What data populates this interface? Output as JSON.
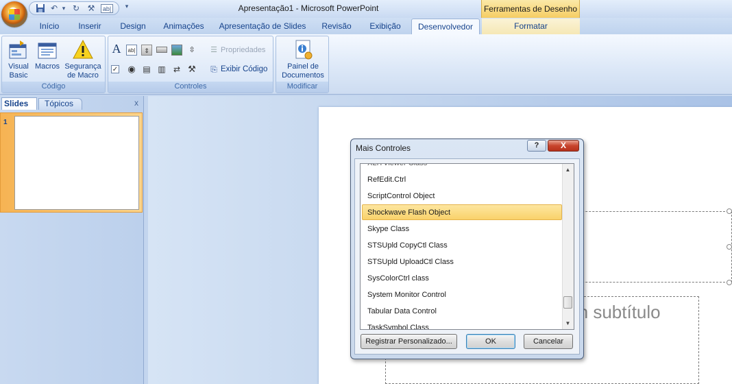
{
  "window": {
    "title": "Apresentação1 - Microsoft PowerPoint",
    "context_tab_group": "Ferramentas de Desenho"
  },
  "quick_access": {
    "icons": [
      "save-icon",
      "undo-icon",
      "redo-icon",
      "tools-icon",
      "textbox-icon",
      "dropdown-icon"
    ]
  },
  "tabs": [
    {
      "label": "Início"
    },
    {
      "label": "Inserir"
    },
    {
      "label": "Design"
    },
    {
      "label": "Animações"
    },
    {
      "label": "Apresentação de Slides"
    },
    {
      "label": "Revisão"
    },
    {
      "label": "Exibição"
    },
    {
      "label": "Desenvolvedor",
      "active": true
    },
    {
      "label": "Formatar"
    }
  ],
  "ribbon": {
    "codigo": {
      "label": "Código",
      "visual_basic": "Visual Basic",
      "visual_basic_l1": "Visual",
      "visual_basic_l2": "Basic",
      "macros": "Macros",
      "seguranca_l1": "Segurança",
      "seguranca_l2": "de Macro"
    },
    "controles": {
      "label": "Controles",
      "propriedades": "Propriedades",
      "exibir_codigo": "Exibir Código"
    },
    "modificar": {
      "label": "Modificar",
      "painel_l1": "Painel de",
      "painel_l2": "Documentos"
    }
  },
  "left_panel": {
    "tab_slides": "Slides",
    "tab_topicos": "Tópicos",
    "close": "x",
    "slide_number": "1"
  },
  "slide": {
    "subtitle_placeholder": "um subtítulo"
  },
  "dialog": {
    "title": "Mais Controles",
    "help": "?",
    "close": "X",
    "items": [
      "RefEdit.Ctrl",
      "ScriptControl Object",
      "Shockwave Flash Object",
      "Skype Class",
      "STSUpld CopyCtl Class",
      "STSUpld UploadCtl Class",
      "SysColorCtrl class",
      "System Monitor Control",
      "Tabular Data Control",
      "TaskSymbol Class"
    ],
    "selected_item": "Shockwave Flash Object",
    "btn_registrar": "Registrar Personalizado...",
    "btn_ok": "OK",
    "btn_cancelar": "Cancelar"
  },
  "colors": {
    "ribbon_accent": "#15428b",
    "selection": "#f9d26a",
    "context_tab": "#f6cd63"
  }
}
